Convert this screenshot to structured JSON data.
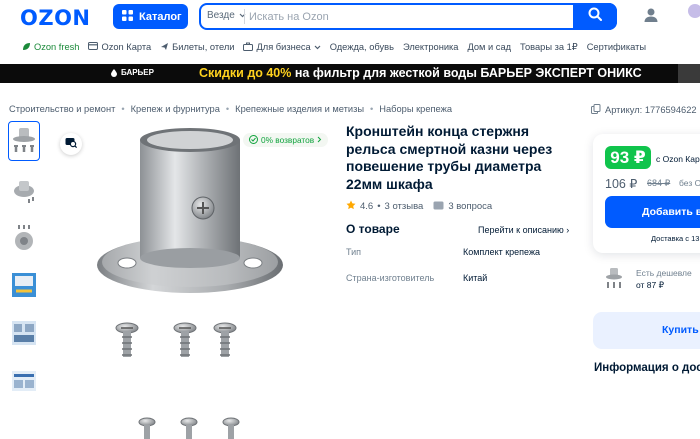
{
  "header": {
    "logo": "OZON",
    "catalog_label": "Каталог",
    "search_scope": "Везде",
    "search_placeholder": "Искать на Ozon"
  },
  "nav": {
    "items": [
      {
        "label": "Ozon fresh",
        "icon": "leaf-icon"
      },
      {
        "label": "Ozon Карта",
        "icon": "card-icon"
      },
      {
        "label": "Билеты, отели",
        "icon": "plane-icon"
      },
      {
        "label": "Для бизнеса",
        "icon": "briefcase-icon"
      },
      {
        "label": "Одежда, обувь"
      },
      {
        "label": "Электроника"
      },
      {
        "label": "Дом и сад"
      },
      {
        "label": "Товары за 1₽"
      },
      {
        "label": "Сертификаты"
      }
    ]
  },
  "banner": {
    "brand": "БАРЬЕР",
    "text_accent": "Скидки до 40%",
    "text_rest": "на фильтр для жесткой воды БАРЬЕР ЭКСПЕРТ ОНИКС"
  },
  "breadcrumbs": [
    "Строительство и ремонт",
    "Крепеж и фурнитура",
    "Крепежные изделия и метизы",
    "Наборы крепежа"
  ],
  "article": "Артикул: 1776594622",
  "product": {
    "returns_badge": "0% возвратов",
    "title": "Кронштейн конца стержня рельса смертной казни через повешение трубы диаметра 22мм шкафа",
    "rating": "4.6",
    "reviews": "3 отзыва",
    "questions": "3 вопроса",
    "about_title": "О товаре",
    "about_link": "Перейти к описанию",
    "specs": [
      {
        "name": "Тип",
        "value": "Комплект крепежа"
      },
      {
        "name": "Страна-изготовитель",
        "value": "Китай"
      }
    ]
  },
  "price": {
    "card_price": "93 ₽",
    "card_label": "с Ozon Кар",
    "regular_price": "106 ₽",
    "old_price": "684 ₽",
    "no_card_label": "без Ozon",
    "add_button": "Добавить в к",
    "delivery": "Доставка с 13"
  },
  "cheaper": {
    "label": "Есть дешевле",
    "value": "от 87 ₽"
  },
  "buy_quick": "Купить в",
  "info_title": "Информация о дос",
  "colors": {
    "brand_blue": "#005bff",
    "green": "#10c44c",
    "text": "#001a34"
  }
}
